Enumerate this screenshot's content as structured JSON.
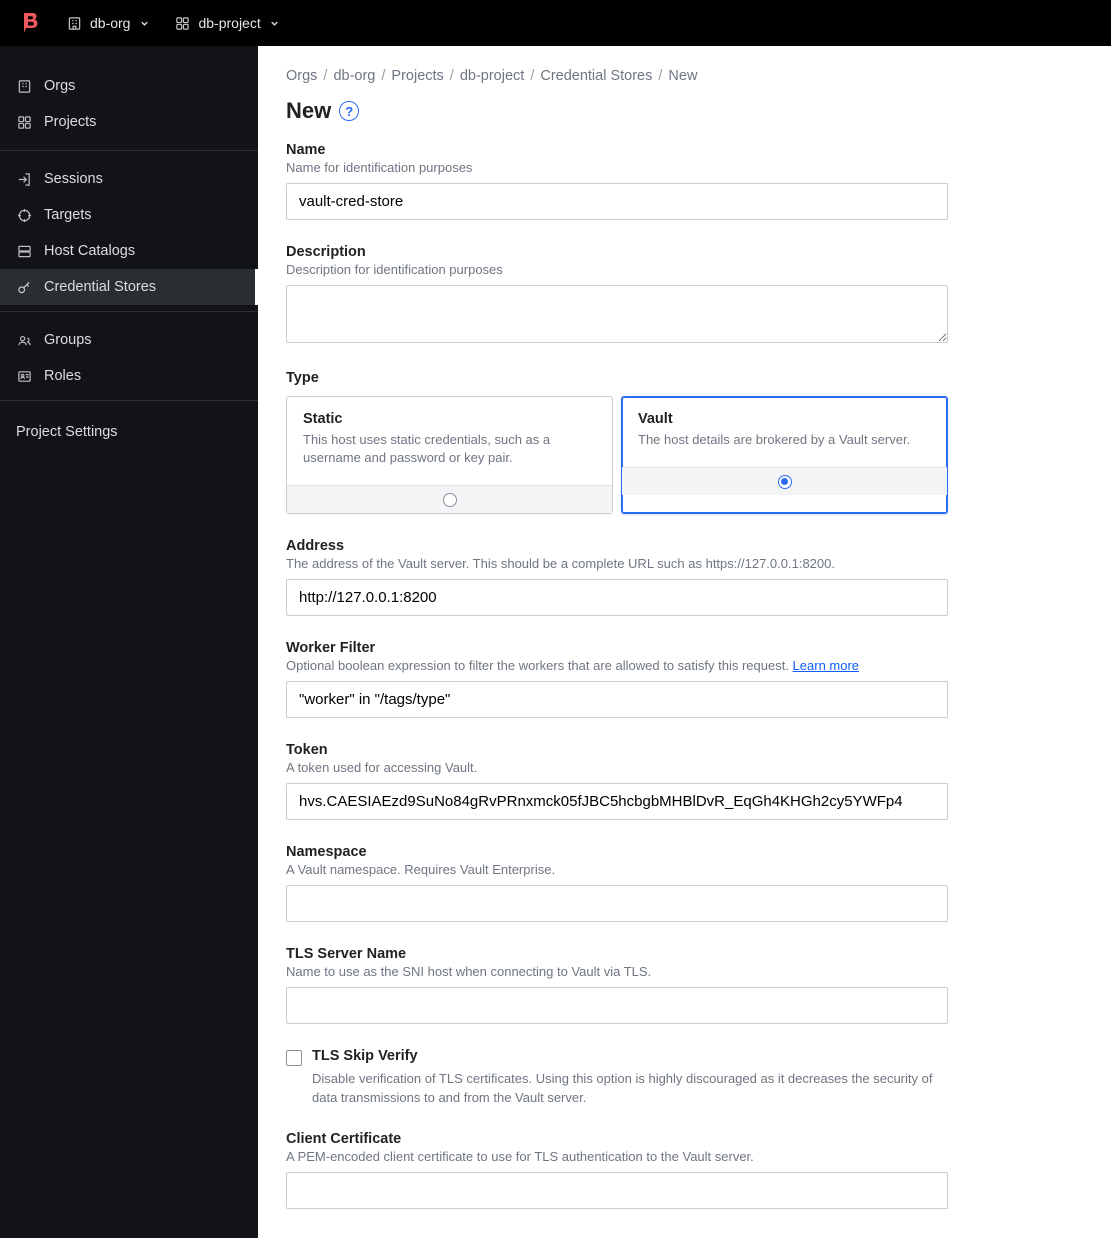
{
  "topbar": {
    "org": "db-org",
    "project": "db-project"
  },
  "sidebar": {
    "orgs": "Orgs",
    "projects": "Projects",
    "sessions": "Sessions",
    "targets": "Targets",
    "host_catalogs": "Host Catalogs",
    "credential_stores": "Credential Stores",
    "groups": "Groups",
    "roles": "Roles",
    "project_settings": "Project Settings"
  },
  "breadcrumbs": [
    "Orgs",
    "db-org",
    "Projects",
    "db-project",
    "Credential Stores",
    "New"
  ],
  "page_title": "New",
  "fields": {
    "name": {
      "label": "Name",
      "hint": "Name for identification purposes",
      "value": "vault-cred-store"
    },
    "description": {
      "label": "Description",
      "hint": "Description for identification purposes",
      "value": ""
    },
    "type": {
      "label": "Type",
      "options": {
        "static": {
          "title": "Static",
          "desc": "This host uses static credentials, such as a username and password or key pair."
        },
        "vault": {
          "title": "Vault",
          "desc": "The host details are brokered by a Vault server."
        }
      },
      "selected": "vault"
    },
    "address": {
      "label": "Address",
      "hint": "The address of the Vault server. This should be a complete URL such as https://127.0.0.1:8200.",
      "value": "http://127.0.0.1:8200"
    },
    "worker_filter": {
      "label": "Worker Filter",
      "hint": "Optional boolean expression to filter the workers that are allowed to satisfy this request. ",
      "learn_more": "Learn more",
      "value": "\"worker\" in \"/tags/type\""
    },
    "token": {
      "label": "Token",
      "hint": "A token used for accessing Vault.",
      "value": "hvs.CAESIAEzd9SuNo84gRvPRnxmck05fJBC5hcbgbMHBlDvR_EqGh4KHGh2cy5YWFp4"
    },
    "namespace": {
      "label": "Namespace",
      "hint": "A Vault namespace. Requires Vault Enterprise.",
      "value": ""
    },
    "tls_server_name": {
      "label": "TLS Server Name",
      "hint": "Name to use as the SNI host when connecting to Vault via TLS.",
      "value": ""
    },
    "tls_skip_verify": {
      "label": "TLS Skip Verify",
      "desc": "Disable verification of TLS certificates. Using this option is highly discouraged as it decreases the security of data transmissions to and from the Vault server."
    },
    "client_cert": {
      "label": "Client Certificate",
      "hint": "A PEM-encoded client certificate to use for TLS authentication to the Vault server.",
      "value": ""
    }
  }
}
